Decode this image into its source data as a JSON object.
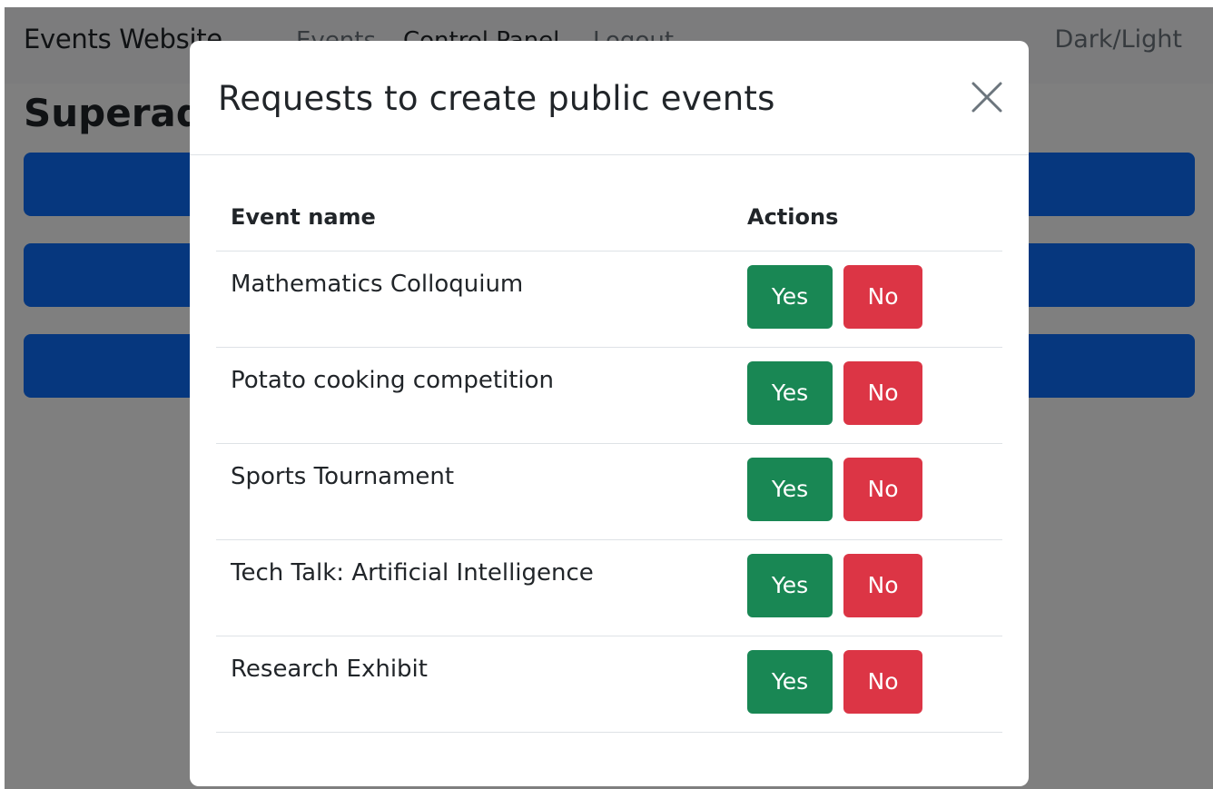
{
  "navbar": {
    "brand": "Events Website",
    "links": [
      "Events",
      "Control Panel",
      "Logout"
    ],
    "theme_toggle": "Dark/Light"
  },
  "page": {
    "title": "Superadmin"
  },
  "modal": {
    "title": "Requests to create public events",
    "table": {
      "headers": [
        "Event name",
        "Actions"
      ],
      "rows": [
        {
          "name": "Mathematics Colloquium",
          "yes": "Yes",
          "no": "No"
        },
        {
          "name": "Potato cooking competition",
          "yes": "Yes",
          "no": "No"
        },
        {
          "name": "Sports Tournament",
          "yes": "Yes",
          "no": "No"
        },
        {
          "name": "Tech Talk: Artificial Intelligence",
          "yes": "Yes",
          "no": "No"
        },
        {
          "name": "Research Exhibit",
          "yes": "Yes",
          "no": "No"
        }
      ]
    }
  },
  "colors": {
    "primary": "#0d6efd",
    "success": "#198754",
    "danger": "#dc3545"
  },
  "icons": {
    "close": "close-icon"
  }
}
